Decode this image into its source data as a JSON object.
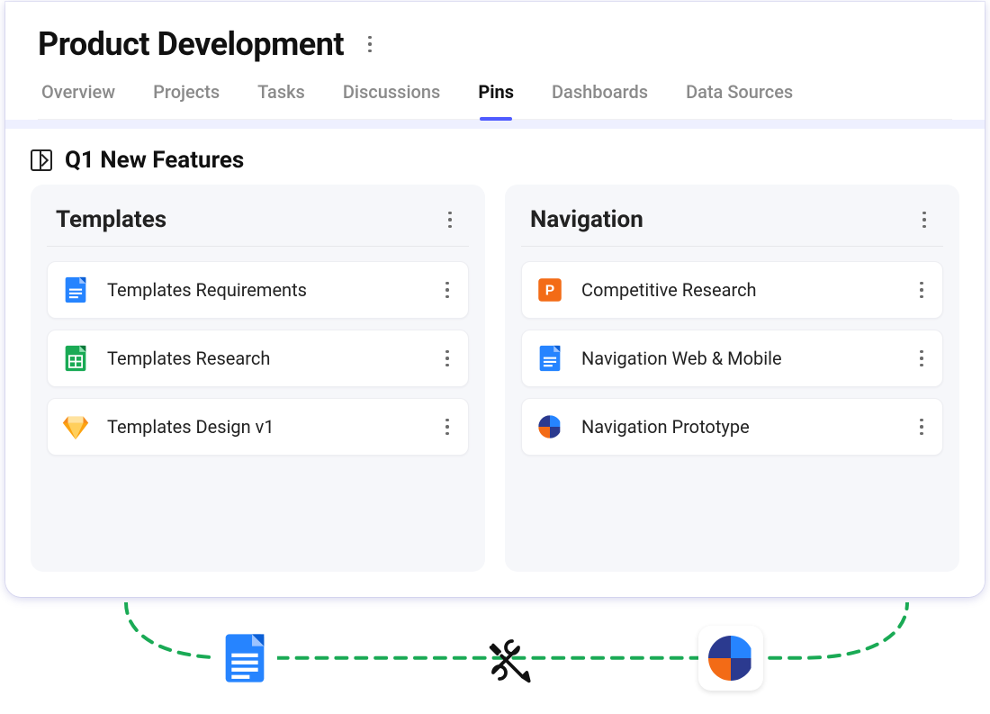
{
  "page": {
    "title": "Product Development"
  },
  "tabs": [
    {
      "label": "Overview",
      "active": false
    },
    {
      "label": "Projects",
      "active": false
    },
    {
      "label": "Tasks",
      "active": false
    },
    {
      "label": "Discussions",
      "active": false
    },
    {
      "label": "Pins",
      "active": true
    },
    {
      "label": "Dashboards",
      "active": false
    },
    {
      "label": "Data Sources",
      "active": false
    }
  ],
  "section": {
    "title": "Q1 New Features"
  },
  "cards": [
    {
      "title": "Templates",
      "items": [
        {
          "icon": "gdoc-icon",
          "label": "Templates Requirements"
        },
        {
          "icon": "gsheet-icon",
          "label": "Templates Research"
        },
        {
          "icon": "sketch-icon",
          "label": "Templates Design v1"
        }
      ]
    },
    {
      "title": "Navigation",
      "items": [
        {
          "icon": "powerpoint-icon",
          "label": "Competitive Research"
        },
        {
          "icon": "gdoc-icon",
          "label": "Navigation Web & Mobile"
        },
        {
          "icon": "prototype-icon",
          "label": "Navigation Prototype"
        }
      ]
    }
  ],
  "colors": {
    "accent": "#4f5bff",
    "doc_blue": "#2684ff",
    "sheet_green": "#1aaa55",
    "ppt_orange": "#f36b16",
    "sketch_orange": "#fca311",
    "dash_green": "#1aaa55"
  },
  "footer": {
    "left_icon": "gdoc-icon",
    "center_icon": "tools-icon",
    "right_icon": "prototype-icon"
  }
}
